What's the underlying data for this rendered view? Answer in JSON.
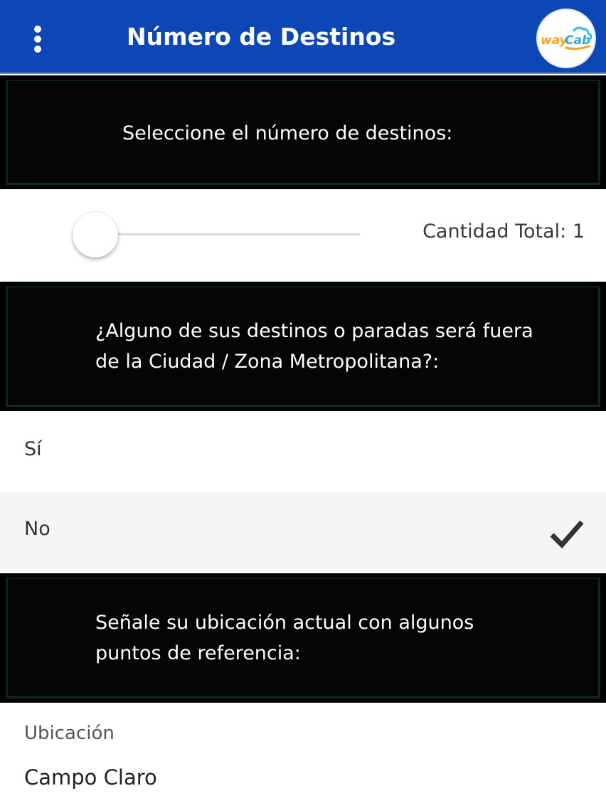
{
  "appbar": {
    "title": "Número de Destinos",
    "menu_icon": "more-vert-icon",
    "logo_text_a": "way",
    "logo_text_b": "Cab",
    "brand_color": "#0d47b6"
  },
  "section_destinations": {
    "prompt": "Seleccione el número de destinos:"
  },
  "slider": {
    "value": 1,
    "min": 1,
    "total_label": "Cantidad Total: 1"
  },
  "section_outside": {
    "prompt_line1": "¿Alguno de sus destinos o paradas será fuera",
    "prompt_line2": "de la Ciudad / Zona Metropolitana?:",
    "options": [
      {
        "label": "Sí",
        "selected": false
      },
      {
        "label": "No",
        "selected": true
      }
    ]
  },
  "section_location": {
    "prompt_line1": "Señale su ubicación actual con algunos",
    "prompt_line2": "puntos de referencia:",
    "field_label": "Ubicación",
    "field_value": "Campo Claro"
  }
}
